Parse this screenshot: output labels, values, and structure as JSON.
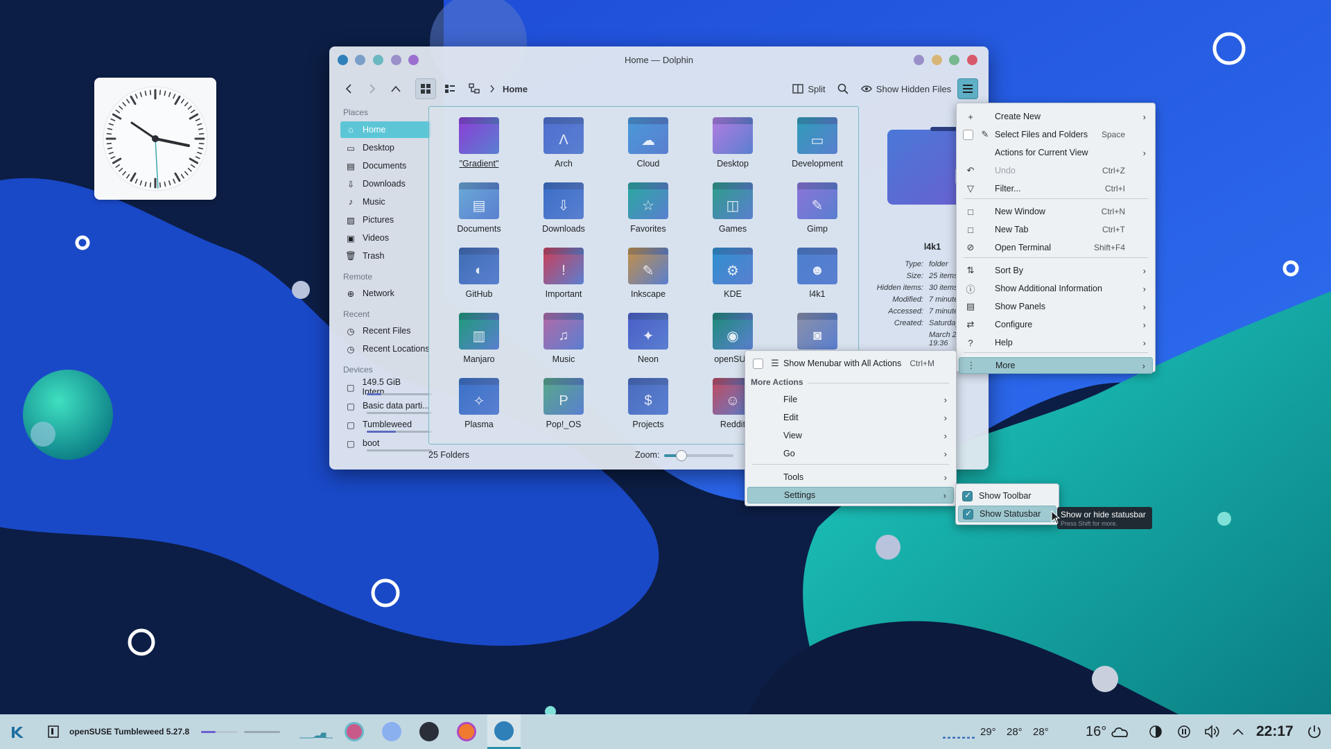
{
  "window": {
    "title": "Home — Dolphin",
    "breadcrumb": "Home",
    "split_label": "Split",
    "hidden_files_label": "Show Hidden Files"
  },
  "places": {
    "heading_places": "Places",
    "heading_remote": "Remote",
    "heading_recent": "Recent",
    "heading_devices": "Devices",
    "items": [
      "Home",
      "Desktop",
      "Documents",
      "Downloads",
      "Music",
      "Pictures",
      "Videos",
      "Trash"
    ],
    "remote": [
      "Network"
    ],
    "recent": [
      "Recent Files",
      "Recent Locations"
    ],
    "devices": [
      {
        "label": "149.5 GiB Intern...",
        "used": 0.22
      },
      {
        "label": "Basic data parti...",
        "used": 0.0
      },
      {
        "label": "Tumbleweed",
        "used": 0.45
      },
      {
        "label": "boot",
        "used": 0.0
      }
    ]
  },
  "folders": [
    "\"Gradient\"",
    "Arch",
    "Cloud",
    "Desktop",
    "Development",
    "Documents",
    "Downloads",
    "Favorites",
    "Games",
    "Gimp",
    "GitHub",
    "Important",
    "Inkscape",
    "KDE",
    "l4k1",
    "Manjaro",
    "Music",
    "Neon",
    "openSUS",
    "",
    "Plasma",
    "Pop!_OS",
    "Projects",
    "Reddit"
  ],
  "folder_colors": [
    "#8a3fd6",
    "#4f6fcf",
    "#4a98d8",
    "#b07ce0",
    "#2f9cb8",
    "#6aa8d6",
    "#3b6fc7",
    "#2aa8a0",
    "#2f9c8a",
    "#8a74d8",
    "#3f6db5",
    "#c7405c",
    "#c08f4a",
    "#2f8fd0",
    "#4d7fcf",
    "#1f9a7a",
    "#b06aa8",
    "#4a5fc8",
    "#1f8b7a",
    "#8a8fa8",
    "#3a72c8",
    "#58a88a",
    "#4a6cc0",
    "#c04a60"
  ],
  "statusbar": {
    "count": "25 Folders",
    "zoom_label": "Zoom:",
    "zoom_level": 0.25
  },
  "info": {
    "name": "l4k1",
    "rows": [
      {
        "k": "Type:",
        "v": "folder"
      },
      {
        "k": "Size:",
        "v": "25 items"
      },
      {
        "k": "Hidden items:",
        "v": "30 items"
      },
      {
        "k": "Modified:",
        "v": "7 minutes"
      },
      {
        "k": "Accessed:",
        "v": "7 minutes"
      },
      {
        "k": "Created:",
        "v": "Saturday,"
      }
    ],
    "created_extra": [
      "March 20",
      "19:36"
    ]
  },
  "main_menu": {
    "items": [
      {
        "label": "Create New",
        "short": "",
        "arrow": true,
        "icon": "+"
      },
      {
        "label": "Select Files and Folders",
        "short": "Space",
        "arrow": false,
        "icon": "✎"
      },
      {
        "label": "Actions for Current View",
        "short": "",
        "arrow": true,
        "icon": ""
      },
      {
        "label": "Undo",
        "short": "Ctrl+Z",
        "arrow": false,
        "icon": "↶"
      },
      {
        "label": "Filter...",
        "short": "Ctrl+I",
        "arrow": false,
        "icon": "▽"
      },
      {
        "label": "New Window",
        "short": "Ctrl+N",
        "arrow": false,
        "icon": "□"
      },
      {
        "label": "New Tab",
        "short": "Ctrl+T",
        "arrow": false,
        "icon": "□"
      },
      {
        "label": "Open Terminal",
        "short": "Shift+F4",
        "arrow": false,
        "icon": "⊘"
      },
      {
        "label": "Sort By",
        "short": "",
        "arrow": true,
        "icon": "⇅"
      },
      {
        "label": "Show Additional Information",
        "short": "",
        "arrow": true,
        "icon": "ⓘ"
      },
      {
        "label": "Show Panels",
        "short": "",
        "arrow": true,
        "icon": "▤"
      },
      {
        "label": "Configure",
        "short": "",
        "arrow": true,
        "icon": "⇄"
      },
      {
        "label": "Help",
        "short": "",
        "arrow": true,
        "icon": "?"
      },
      {
        "label": "More",
        "short": "",
        "arrow": true,
        "icon": "⋮"
      }
    ]
  },
  "more_menu": {
    "show_menubar": "Show Menubar with All Actions",
    "show_menubar_short": "Ctrl+M",
    "section": "More Actions",
    "items": [
      "File",
      "Edit",
      "View",
      "Go",
      "Tools",
      "Settings"
    ]
  },
  "settings_menu": {
    "items": [
      "Show Toolbar",
      "Show Statusbar"
    ]
  },
  "tooltip": {
    "title": "Show or hide statusbar",
    "hint": "Press Shift for more."
  },
  "taskbar": {
    "pager_label": "openSUSE Tumbleweed 5.27.8",
    "temps": [
      "29°",
      "28°",
      "28°"
    ],
    "weather": "16°",
    "time": "22:17"
  }
}
